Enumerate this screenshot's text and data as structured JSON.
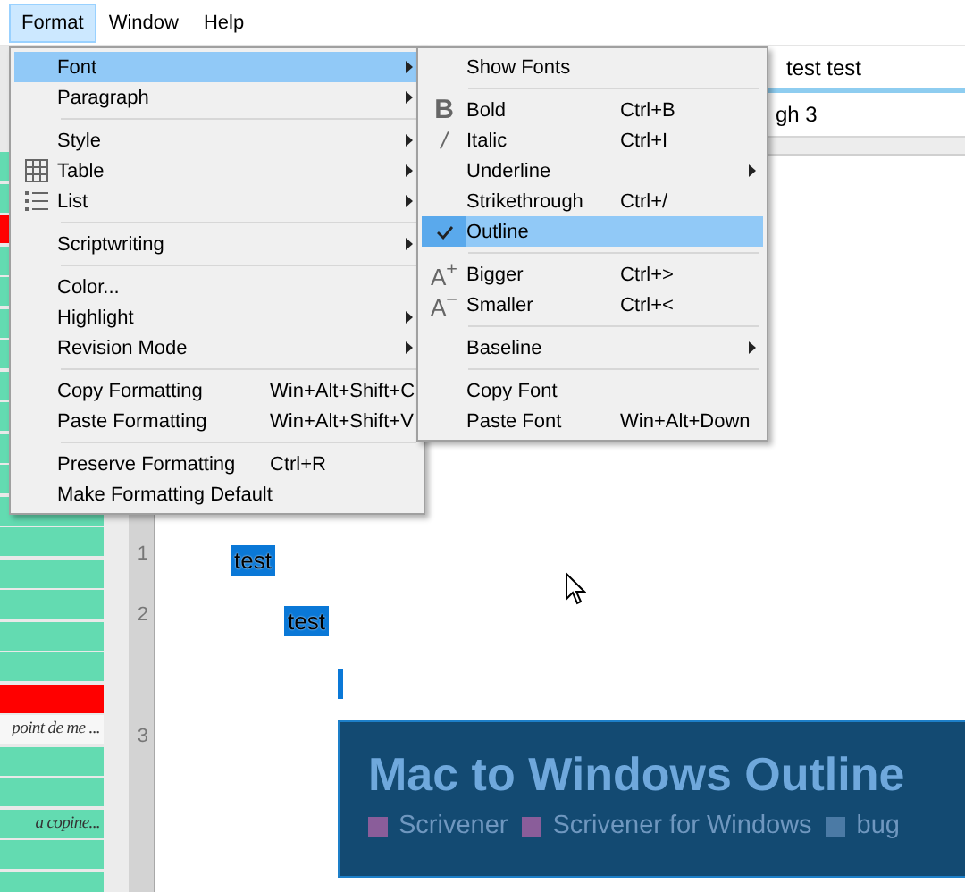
{
  "menubar": [
    {
      "label": "Format",
      "selected": true
    },
    {
      "label": "Window",
      "selected": false
    },
    {
      "label": "Help",
      "selected": false
    }
  ],
  "format_menu": {
    "items": [
      {
        "kind": "item",
        "label": "Font",
        "submenu": true,
        "selected": true
      },
      {
        "kind": "item",
        "label": "Paragraph",
        "submenu": true,
        "selected": false
      },
      {
        "kind": "separator"
      },
      {
        "kind": "item",
        "label": "Style",
        "submenu": true,
        "selected": false
      },
      {
        "kind": "table",
        "label": "Table",
        "submenu": true,
        "selected": false
      },
      {
        "kind": "list",
        "label": "List",
        "submenu": true,
        "selected": false
      },
      {
        "kind": "separator"
      },
      {
        "kind": "item",
        "label": "Scriptwriting",
        "submenu": true,
        "selected": false
      },
      {
        "kind": "separator"
      },
      {
        "kind": "item",
        "label": "Color...",
        "selected": false
      },
      {
        "kind": "item",
        "label": "Highlight",
        "submenu": true,
        "selected": false
      },
      {
        "kind": "item",
        "label": "Revision Mode",
        "submenu": true,
        "selected": false
      },
      {
        "kind": "separator"
      },
      {
        "kind": "item",
        "label": "Copy Formatting",
        "shortcut": "Win+Alt+Shift+C",
        "selected": false
      },
      {
        "kind": "item",
        "label": "Paste Formatting",
        "shortcut": "Win+Alt+Shift+V",
        "selected": false
      },
      {
        "kind": "separator"
      },
      {
        "kind": "item",
        "label": "Preserve Formatting",
        "shortcut": "Ctrl+R",
        "selected": false
      },
      {
        "kind": "item",
        "label": "Make Formatting Default",
        "selected": false
      }
    ]
  },
  "font_menu": {
    "items": [
      {
        "kind": "item",
        "label": "Show Fonts",
        "selected": false,
        "checked": false
      },
      {
        "kind": "separator"
      },
      {
        "kind": "bold",
        "label": "Bold",
        "glyph": "B",
        "shortcut": "Ctrl+B",
        "selected": false,
        "checked": false
      },
      {
        "kind": "italic",
        "label": "Italic",
        "glyph": "/",
        "shortcut": "Ctrl+I",
        "selected": false,
        "checked": false
      },
      {
        "kind": "item",
        "label": "Underline",
        "submenu": true,
        "selected": false,
        "checked": false
      },
      {
        "kind": "item",
        "label": "Strikethrough",
        "shortcut": "Ctrl+/",
        "selected": false,
        "checked": false
      },
      {
        "kind": "item",
        "label": "Outline",
        "selected": true,
        "checked": true
      },
      {
        "kind": "separator"
      },
      {
        "kind": "size",
        "label": "Bigger",
        "glyph": "A$^{+}$",
        "shortcut": "Ctrl+>",
        "selected": false,
        "checked": false
      },
      {
        "kind": "size",
        "label": "Smaller",
        "glyph": "A$^{−}$",
        "shortcut": "Ctrl+<",
        "selected": false,
        "checked": false
      },
      {
        "kind": "separator"
      },
      {
        "kind": "item",
        "label": "Baseline",
        "submenu": true,
        "selected": false,
        "checked": false
      },
      {
        "kind": "separator"
      },
      {
        "kind": "item",
        "label": "Copy Font",
        "selected": false,
        "checked": false
      },
      {
        "kind": "item",
        "label": "Paste Font",
        "shortcut": "Win+Alt+Down",
        "selected": false,
        "checked": false
      }
    ]
  },
  "binder": {
    "rows": [
      {
        "color": "#63dbb1"
      },
      {
        "color": "#63dbb1"
      },
      {
        "color": "#ff0000"
      },
      {
        "color": "#63dbb1"
      },
      {
        "color": "#63dbb1"
      },
      {
        "color": "#63dbb1"
      },
      {
        "color": "#63dbb1"
      },
      {
        "color": "#63dbb1"
      },
      {
        "color": "#63dbb1"
      },
      {
        "color": "#63dbb1"
      },
      {
        "color": "#63dbb1"
      },
      {
        "color": "#63dbb1"
      },
      {
        "color": "#63dbb1"
      },
      {
        "color": "#63dbb1"
      },
      {
        "color": "#63dbb1"
      },
      {
        "color": "#63dbb1"
      },
      {
        "color": "#63dbb1"
      },
      {
        "color": "#ff0000"
      },
      {
        "color": "#f7f7f7",
        "text": "point de me ..."
      },
      {
        "color": "#63dbb1"
      },
      {
        "color": "#63dbb1"
      },
      {
        "color": "#63dbb1",
        "text": "a copine..."
      },
      {
        "color": "#63dbb1"
      },
      {
        "color": "#63dbb1"
      }
    ]
  },
  "header_rows": [
    {
      "text": "test test",
      "selected": true
    },
    {
      "text": "gh 3",
      "selected": false
    }
  ],
  "editor": {
    "items": [
      {
        "kind": "text",
        "number": "1",
        "text": "test",
        "selected": true,
        "children": [
          {
            "kind": "text",
            "number": "2",
            "text": "test",
            "selected": true,
            "children": [
              {
                "kind": "cursor"
              },
              {
                "kind": "card",
                "number": "3",
                "title": "Mac to Windows Outline",
                "tags": [
                  {
                    "label": "Scrivener",
                    "color": "#8a5d9a"
                  },
                  {
                    "label": "Scrivener for Windows",
                    "color": "#8a5d9a"
                  },
                  {
                    "label": "bug",
                    "color": "#4b7aa5"
                  }
                ]
              }
            ]
          }
        ]
      }
    ]
  }
}
